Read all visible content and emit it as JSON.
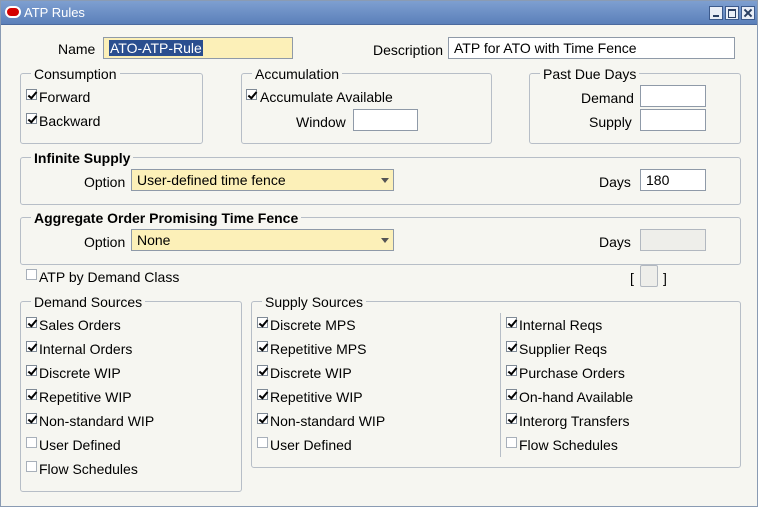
{
  "window": {
    "title": "ATP Rules"
  },
  "name": {
    "label": "Name",
    "value": "ATO-ATP-Rule"
  },
  "description": {
    "label": "Description",
    "value": "ATP for ATO with Time Fence"
  },
  "consumption": {
    "title": "Consumption",
    "forward": "Forward",
    "backward": "Backward",
    "forward_checked": true,
    "backward_checked": true
  },
  "accumulation": {
    "title": "Accumulation",
    "accumulate_available": "Accumulate Available",
    "checked": true,
    "window_label": "Window",
    "window_value": ""
  },
  "past_due": {
    "title": "Past Due Days",
    "demand_label": "Demand",
    "demand_value": "",
    "supply_label": "Supply",
    "supply_value": ""
  },
  "infinite_supply": {
    "title": "Infinite Supply",
    "option_label": "Option",
    "option_value": "User-defined time fence",
    "days_label": "Days",
    "days_value": "180"
  },
  "aggregate": {
    "title": "Aggregate Order Promising Time Fence",
    "option_label": "Option",
    "option_value": "None",
    "days_label": "Days",
    "days_value": ""
  },
  "atp_by_demand_class": {
    "label": "ATP by Demand Class",
    "checked": false
  },
  "bracket": {
    "open": "[",
    "close": "]"
  },
  "demand_sources": {
    "title": "Demand Sources",
    "items": [
      {
        "label": "Sales Orders",
        "checked": true
      },
      {
        "label": "Internal Orders",
        "checked": true
      },
      {
        "label": "Discrete WIP",
        "checked": true
      },
      {
        "label": "Repetitive WIP",
        "checked": true
      },
      {
        "label": "Non-standard WIP",
        "checked": true
      },
      {
        "label": "User Defined",
        "checked": false
      },
      {
        "label": "Flow Schedules",
        "checked": false
      }
    ]
  },
  "supply_sources": {
    "title": "Supply Sources",
    "left": [
      {
        "label": "Discrete MPS",
        "checked": true
      },
      {
        "label": "Repetitive MPS",
        "checked": true
      },
      {
        "label": "Discrete WIP",
        "checked": true
      },
      {
        "label": "Repetitive WIP",
        "checked": true
      },
      {
        "label": "Non-standard WIP",
        "checked": true
      },
      {
        "label": "User Defined",
        "checked": false
      }
    ],
    "right": [
      {
        "label": "Internal Reqs",
        "checked": true
      },
      {
        "label": "Supplier Reqs",
        "checked": true
      },
      {
        "label": "Purchase Orders",
        "checked": true
      },
      {
        "label": "On-hand Available",
        "checked": true
      },
      {
        "label": "Interorg Transfers",
        "checked": true
      },
      {
        "label": "Flow Schedules",
        "checked": false
      }
    ]
  },
  "colors": {
    "titlebar": "#6d8fc6",
    "required_field": "#fcf0b8",
    "background": "#f6f6f1"
  }
}
